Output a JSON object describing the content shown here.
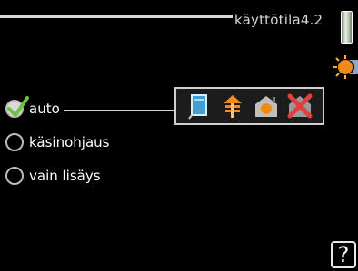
{
  "header": {
    "title": "käyttötila4.2"
  },
  "options": [
    {
      "label": "auto",
      "selected": true
    },
    {
      "label": "käsinohjaus",
      "selected": false
    },
    {
      "label": "vain lisäys",
      "selected": false
    }
  ],
  "mode_panel": {
    "icons": [
      "compressor-icon",
      "additional-heat-icon",
      "heating-icon",
      "cooling-blocked-icon"
    ]
  },
  "help": {
    "label": "?"
  },
  "colors": {
    "background": "#000000",
    "text": "#ffffff",
    "check_green": "#6cc23a",
    "blocked_red": "#e04040"
  }
}
